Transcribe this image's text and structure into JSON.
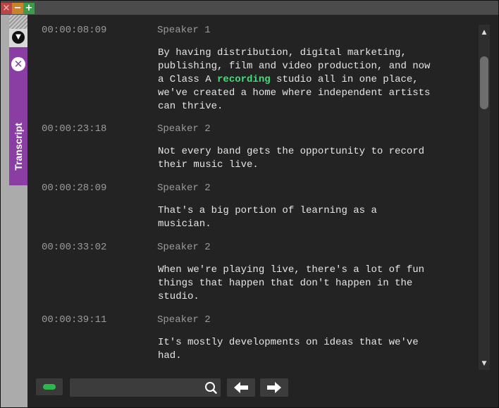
{
  "window": {
    "controls": {
      "close": "×",
      "minimize": "−",
      "maximize": "+"
    }
  },
  "sidebar": {
    "menu_icon": "▼",
    "close_icon": "✕",
    "tab_label": "Transcript"
  },
  "transcript": [
    {
      "time": "00:00:08:09",
      "speaker": "Speaker 1",
      "text_before": "By having distribution, digital marketing,\npublishing, film and video production, and now\na Class A ",
      "highlight": "recording",
      "text_after": " studio all in one place,\nwe've created a home where independent artists\ncan thrive."
    },
    {
      "time": "00:00:23:18",
      "speaker": "Speaker 2",
      "text": "Not every band gets the opportunity to record\ntheir music live."
    },
    {
      "time": "00:00:28:09",
      "speaker": "Speaker 2",
      "text": "That's a big portion of learning as a\nmusician."
    },
    {
      "time": "00:00:33:02",
      "speaker": "Speaker 2",
      "text": "When we're playing live, there's a lot of fun\nthings that happen that don't happen in the\nstudio."
    },
    {
      "time": "00:00:39:11",
      "speaker": "Speaker 2",
      "text": "It's mostly developments on ideas that we've\nhad."
    }
  ],
  "scrollbar": {
    "up_arrow": "▲",
    "down_arrow": "▼"
  },
  "toolbar": {
    "search_value": "",
    "search_placeholder": ""
  },
  "colors": {
    "highlight": "#3fe079",
    "tab_purple": "#8a3ea4",
    "loop_green": "#2db84b"
  }
}
